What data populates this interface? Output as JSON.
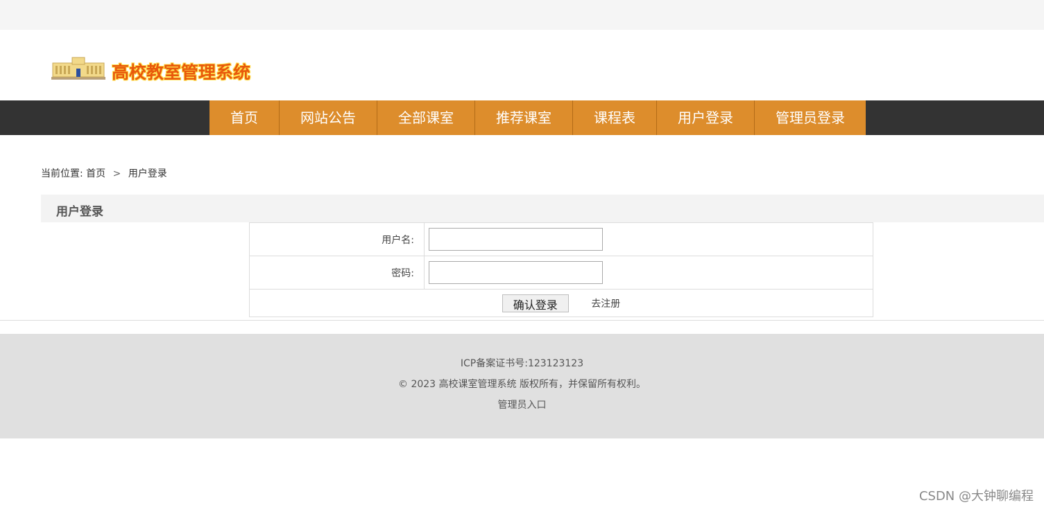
{
  "site": {
    "title": "高校教室管理系统",
    "logo_icon": "school-building-icon"
  },
  "nav": {
    "items": [
      "首页",
      "网站公告",
      "全部课室",
      "推荐课室",
      "课程表",
      "用户登录",
      "管理员登录"
    ],
    "active_color": "#dd8d2c"
  },
  "breadcrumb": {
    "prefix": "当前位置:",
    "home": "首页",
    "separator": ">",
    "current": "用户登录"
  },
  "login": {
    "heading": "用户登录",
    "username_label": "用户名:",
    "username_value": "",
    "password_label": "密码:",
    "password_value": "",
    "submit_label": "确认登录",
    "register_link": "去注册"
  },
  "footer": {
    "icp": "ICP备案证书号:123123123",
    "copyright": "© 2023 高校课室管理系统 版权所有，并保留所有权利。",
    "admin_link": "管理员入口"
  },
  "watermark": "CSDN @大钟聊编程"
}
